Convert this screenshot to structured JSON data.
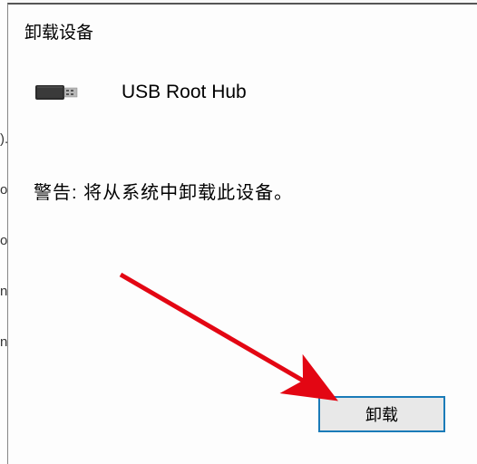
{
  "dialog": {
    "title": "卸载设备",
    "device_name": "USB Root Hub",
    "warning": "警告: 将从系统中卸载此设备。",
    "uninstall_button": "卸载"
  },
  "left_chars": {
    "c1": ").",
    "c2": "o",
    "c3": "o",
    "c4": "n",
    "c5": "n"
  },
  "colors": {
    "border_accent": "#1a7bb8",
    "arrow": "#e30613"
  }
}
